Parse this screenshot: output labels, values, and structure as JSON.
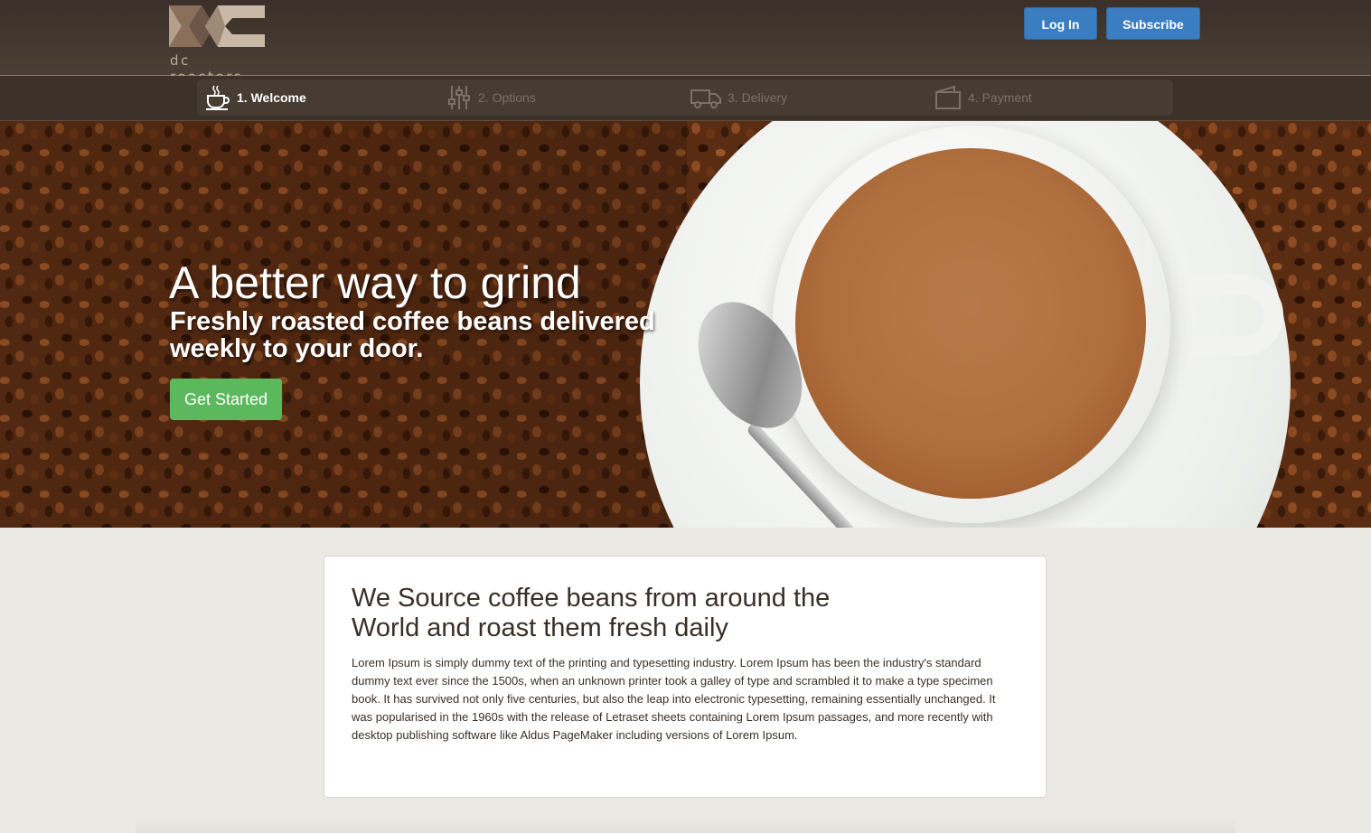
{
  "header": {
    "logo_text": "dc roasters",
    "login_label": "Log In",
    "subscribe_label": "Subscribe"
  },
  "steps": [
    {
      "label": "1. Welcome",
      "icon": "coffee-cup-icon",
      "active": true
    },
    {
      "label": "2. Options",
      "icon": "sliders-icon",
      "active": false
    },
    {
      "label": "3. Delivery",
      "icon": "truck-icon",
      "active": false
    },
    {
      "label": "4. Payment",
      "icon": "wallet-icon",
      "active": false
    }
  ],
  "hero": {
    "title": "A better way to grind",
    "subtitle": "Freshly roasted coffee beans delivered weekly to your door.",
    "cta_label": "Get Started"
  },
  "card": {
    "title": "We Source coffee beans from around the World and roast them fresh daily",
    "body": "Lorem Ipsum is simply dummy text of the printing and typesetting industry. Lorem Ipsum has been the industry's standard dummy text ever since the 1500s, when an unknown printer took a galley of type and scrambled it to make a type specimen book. It has survived not only five centuries, but also the leap into electronic typesetting, remaining essentially unchanged. It was popularised in the 1960s with the release of Letraset sheets containing Lorem Ipsum passages, and more recently with desktop publishing software like Aldus PageMaker including versions of Lorem Ipsum."
  },
  "colors": {
    "header_bg": "#3a3029",
    "button_blue": "#3a7dc0",
    "cta_green": "#5cb85c",
    "page_bg": "#ebe9e4"
  }
}
